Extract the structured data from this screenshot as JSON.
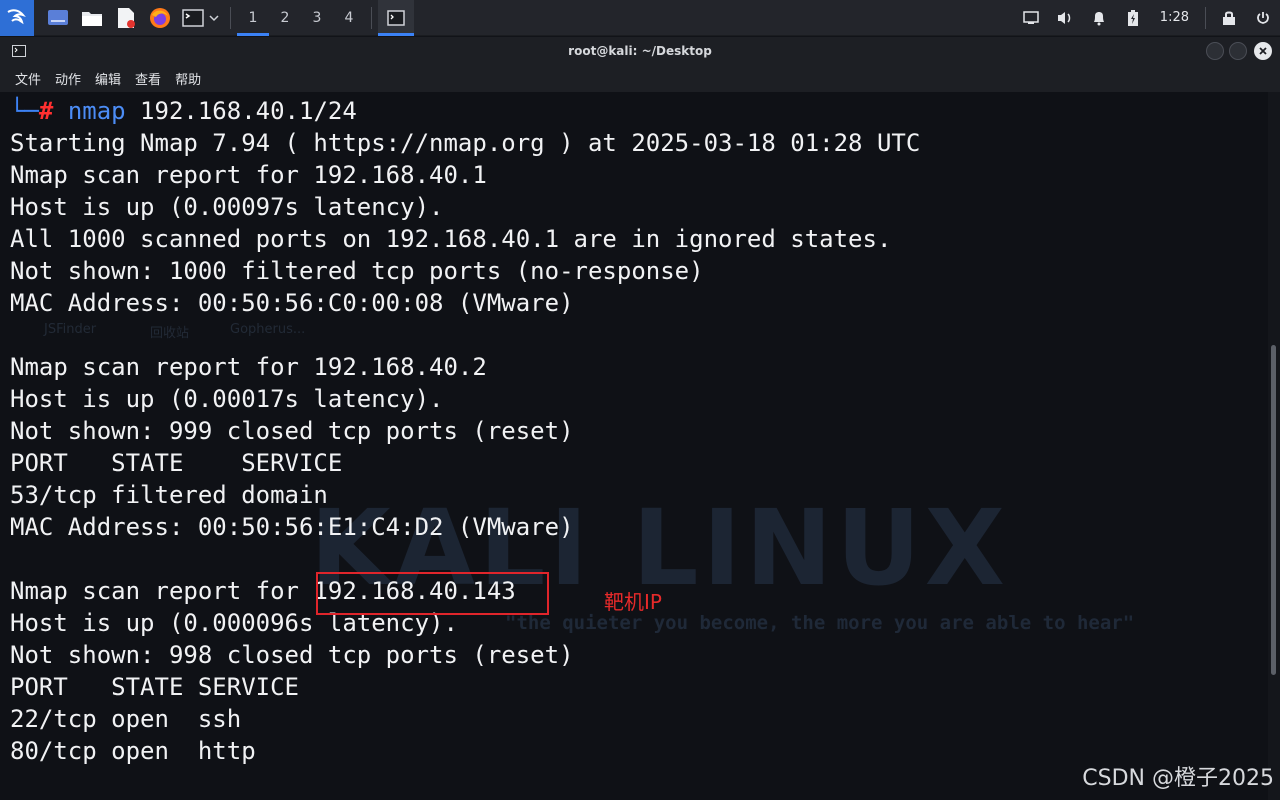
{
  "panel": {
    "workspaces": [
      "1",
      "2",
      "3",
      "4"
    ],
    "active_workspace": "1",
    "clock": "1:28"
  },
  "window": {
    "title": "root@kali: ~/Desktop"
  },
  "menu": [
    "文件",
    "动作",
    "编辑",
    "查看",
    "帮助"
  ],
  "desktop_labels": [
    "JSFinder",
    "回收站",
    "Gopherus..."
  ],
  "watermark": {
    "logo": "KALI LINUX",
    "quote": "\"the quieter you become, the more you are able to hear\""
  },
  "prompt": {
    "corner": "└─",
    "hash": "#",
    "cmd": "nmap",
    "args": " 192.168.40.1/24"
  },
  "output": [
    "Starting Nmap 7.94 ( https://nmap.org ) at 2025-03-18 01:28 UTC",
    "Nmap scan report for 192.168.40.1",
    "Host is up (0.00097s latency).",
    "All 1000 scanned ports on 192.168.40.1 are in ignored states.",
    "Not shown: 1000 filtered tcp ports (no-response)",
    "MAC Address: 00:50:56:C0:00:08 (VMware)",
    "",
    "Nmap scan report for 192.168.40.2",
    "Host is up (0.00017s latency).",
    "Not shown: 999 closed tcp ports (reset)",
    "PORT   STATE    SERVICE",
    "53/tcp filtered domain",
    "MAC Address: 00:50:56:E1:C4:D2 (VMware)",
    "",
    "Nmap scan report for 192.168.40.143",
    "Host is up (0.000096s latency).",
    "Not shown: 998 closed tcp ports (reset)",
    "PORT   STATE SERVICE",
    "22/tcp open  ssh",
    "80/tcp open  http"
  ],
  "annotation": {
    "text": "靶机IP",
    "color": "#e0252b"
  },
  "watermark_credit": "CSDN @橙子2025"
}
